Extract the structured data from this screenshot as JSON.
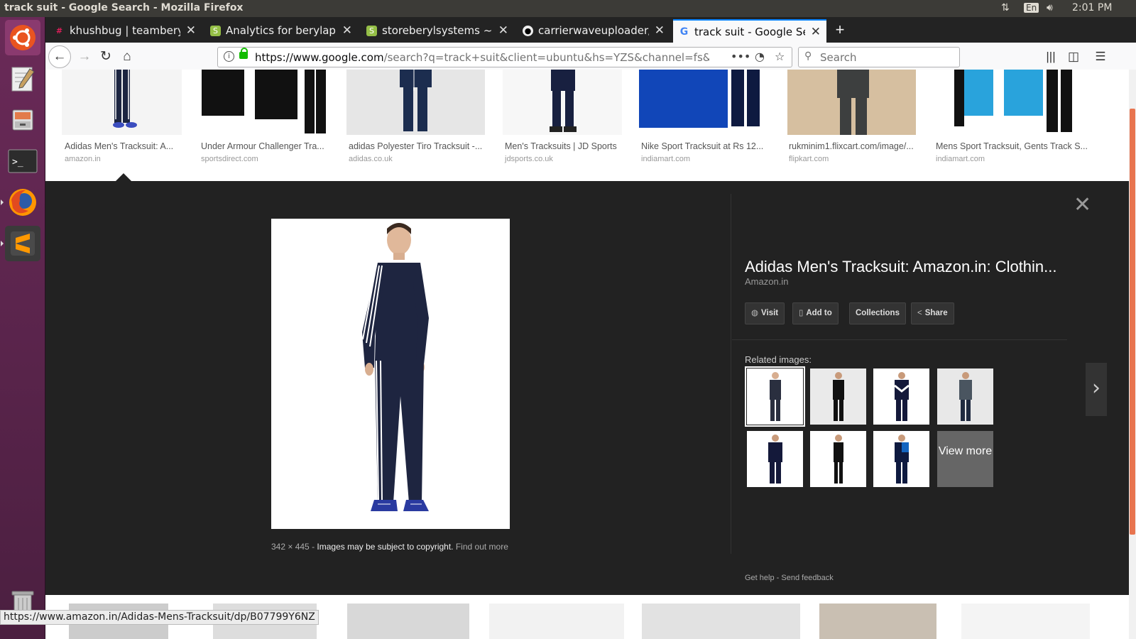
{
  "window": {
    "title": "track suit - Google Search - Mozilla Firefox"
  },
  "system": {
    "keyboard": "En",
    "clock": "2:01 PM"
  },
  "tabs": [
    {
      "label": "khushbug | teamberyl Sl",
      "favicon": "slack-icon"
    },
    {
      "label": "Analytics for berylapp - S",
      "favicon": "shopify-icon"
    },
    {
      "label": "storeberylsystems ~ Pro",
      "favicon": "shopify-icon"
    },
    {
      "label": "carrierwaveuploader/ca",
      "favicon": "github-icon"
    },
    {
      "label": "track suit - Google Searc",
      "favicon": "google-icon",
      "active": true
    }
  ],
  "navbar": {
    "url_host": "https://www.google.com",
    "url_path": "/search?q=track+suit&client=ubuntu&hs=YZS&channel=fs&source=lnm",
    "search_placeholder": "Search"
  },
  "results": [
    {
      "title": "Adidas Men's Tracksuit: A...",
      "source": "amazon.in"
    },
    {
      "title": "Under Armour Challenger Tra...",
      "source": "sportsdirect.com"
    },
    {
      "title": "adidas Polyester Tiro Tracksuit -...",
      "source": "adidas.co.uk"
    },
    {
      "title": "Men's Tracksuits | JD Sports",
      "source": "jdsports.co.uk"
    },
    {
      "title": "Nike Sport Tracksuit at Rs 12...",
      "source": "indiamart.com"
    },
    {
      "title": "rukminim1.flixcart.com/image/...",
      "source": "flipkart.com"
    },
    {
      "title": "Mens Sport Tracksuit, Gents Track S...",
      "source": "indiamart.com"
    }
  ],
  "preview": {
    "title": "Adidas Men's Tracksuit: Amazon.in: Clothin...",
    "source": "Amazon.in",
    "dimensions": "342 × 445",
    "sep": "-",
    "copyright": "Images may be subject to copyright.",
    "find_out_more": "Find out more",
    "actions": {
      "visit": "Visit",
      "add_to": "Add to",
      "collections": "Collections",
      "share": "Share"
    },
    "related_heading": "Related images:",
    "view_more": "View more",
    "get_help": "Get help",
    "send_feedback": "Send feedback"
  },
  "status_url": "https://www.amazon.in/Adidas-Mens-Tracksuit/dp/B07799Y6NZ",
  "colors": {
    "accent_tab": "#0a84ff",
    "launcher": "#5e2750",
    "panel": "#222222",
    "lock_green": "#12bc00"
  }
}
